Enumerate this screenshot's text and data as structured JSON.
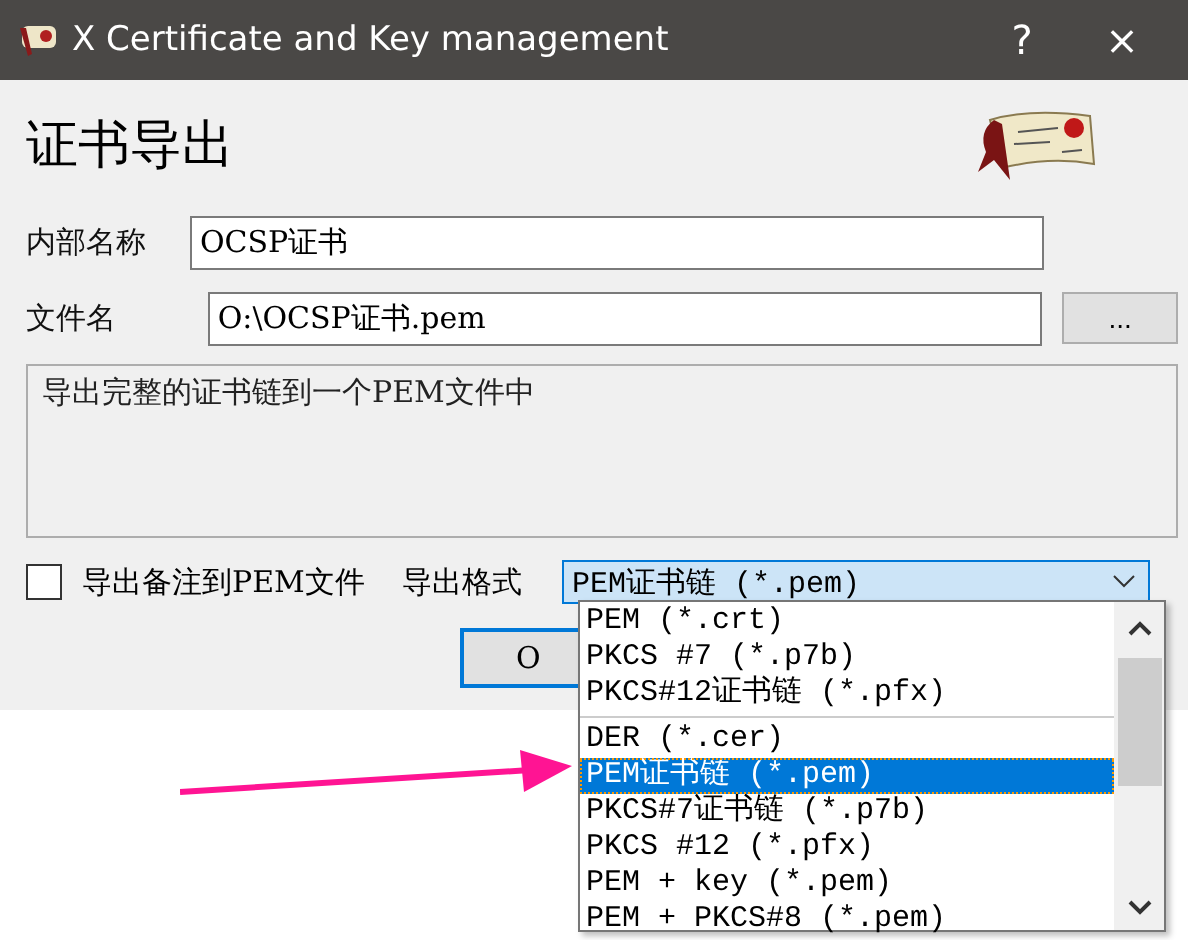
{
  "window": {
    "title": "X Certificate and Key management",
    "buttons": [
      "?",
      "×"
    ]
  },
  "heading": "证书导出",
  "fields": [
    {
      "label": "内部名称",
      "value": "OCSP证书"
    },
    {
      "label": "文件名",
      "value": "O:\\OCSP证书.pem",
      "browse_button": "..."
    }
  ],
  "description": "导出完整的证书链到一个PEM文件中",
  "export_comment": {
    "label": "导出备注到PEM文件",
    "checked": false
  },
  "export_format": {
    "label": "导出格式",
    "value": "PEM证书链 (*.pem)",
    "expanded": true,
    "option_groups": [
      [
        {
          "label": "PEM (*.crt)",
          "selected": false
        },
        {
          "label": "PKCS #7 (*.p7b)",
          "selected": false
        },
        {
          "label": "PKCS#12证书链 (*.pfx)",
          "selected": false
        }
      ],
      [
        {
          "label": "DER (*.cer)",
          "selected": false
        },
        {
          "label": "PEM证书链 (*.pem)",
          "selected": true
        },
        {
          "label": "PKCS#7证书链 (*.p7b)",
          "selected": false
        },
        {
          "label": "PKCS #12 (*.pfx)",
          "selected": false
        },
        {
          "label": "PEM + key (*.pem)",
          "selected": false
        },
        {
          "label": "PEM + PKCS#8 (*.pem)",
          "selected": false
        }
      ]
    ]
  },
  "buttons": [
    "O"
  ]
}
